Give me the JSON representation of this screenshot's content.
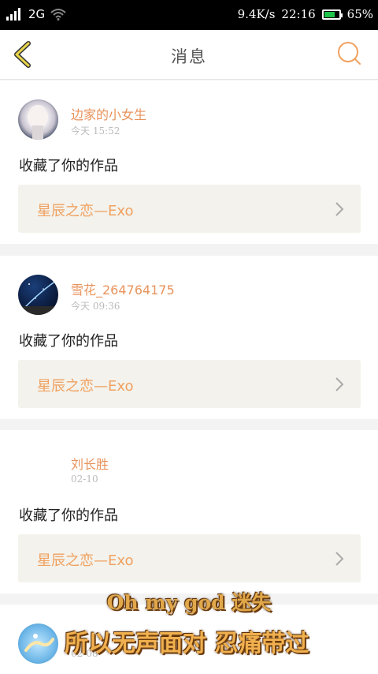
{
  "status_bar": {
    "network": "2G",
    "speed": "9.4K/s",
    "time": "22:16",
    "battery": "65%",
    "battery_level": 0.65,
    "battery_color": "#20c24a"
  },
  "header": {
    "title": "消息",
    "back_icon": "chevron-left-icon",
    "search_icon": "search-icon",
    "accent_color": "#e8935c"
  },
  "messages": [
    {
      "user": "边家的小女生",
      "time": "今天 15:52",
      "action": "收藏了你的作品",
      "work": "星辰之恋—Exo"
    },
    {
      "user": "雪花_264764175",
      "time": "今天 09:36",
      "action": "收藏了你的作品",
      "work": "星辰之恋—Exo"
    },
    {
      "user": "刘长胜",
      "time": "02-10",
      "action": "收藏了你的作品",
      "work": "星辰之恋—Exo"
    },
    {
      "user": "",
      "time": "02-08"
    }
  ],
  "overlay": {
    "line1": "Oh my god 迷失",
    "line2": "所以无声面对 忍痛带过"
  }
}
